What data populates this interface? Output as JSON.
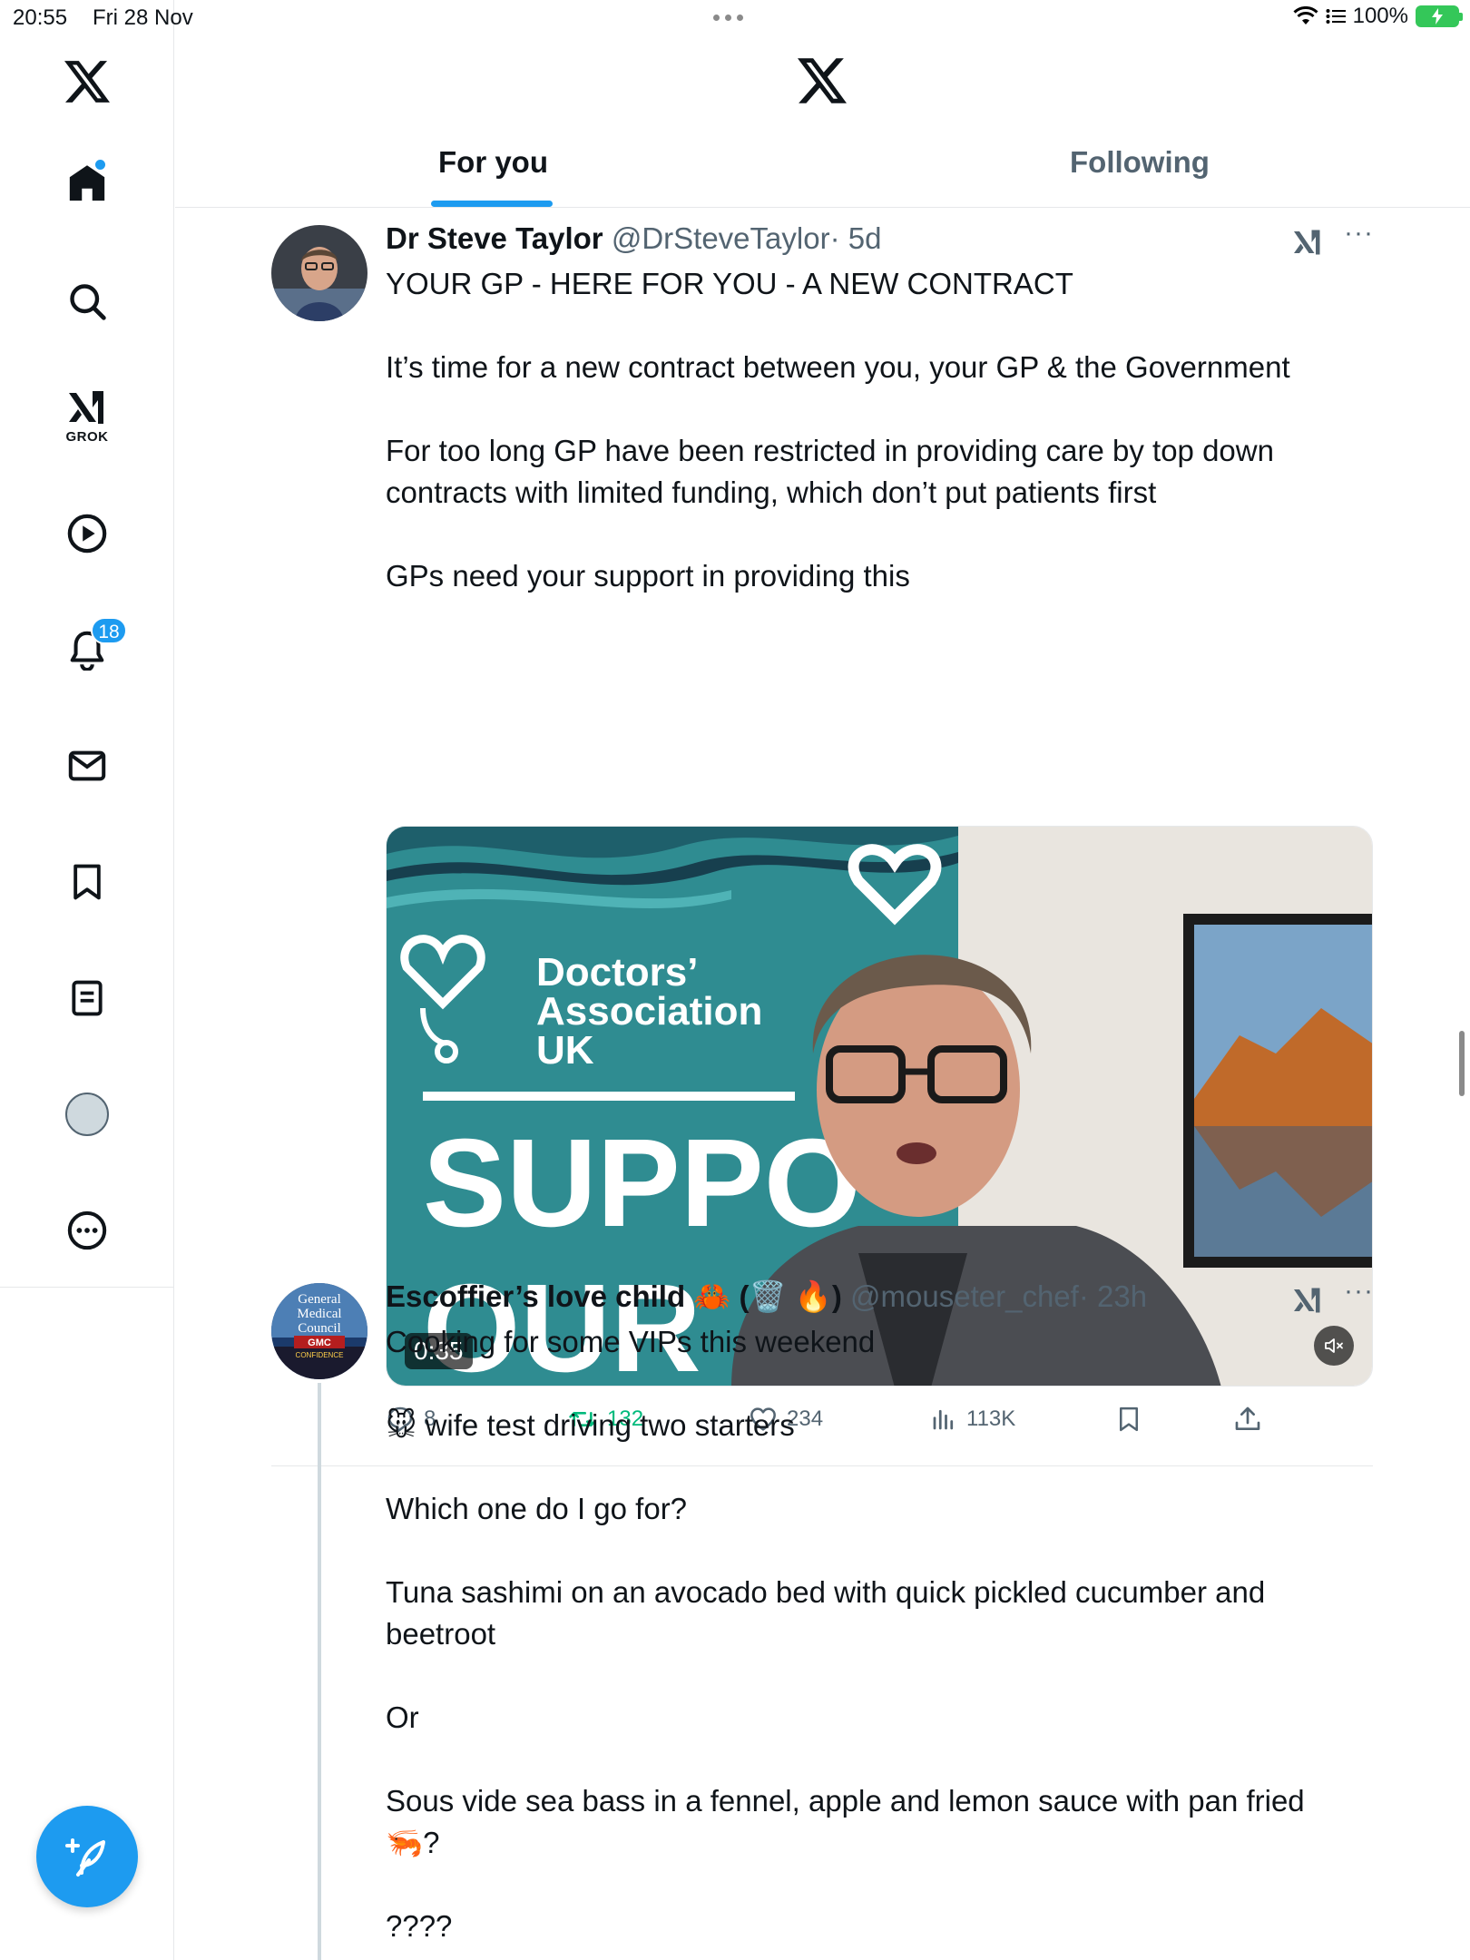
{
  "status_bar": {
    "time": "20:55",
    "date": "Fri 28 Nov",
    "battery": "100%"
  },
  "sidebar": {
    "items": [
      {
        "name": "x-logo"
      },
      {
        "name": "home",
        "has_dot": true
      },
      {
        "name": "search"
      },
      {
        "name": "grok",
        "label": "GROK"
      },
      {
        "name": "video"
      },
      {
        "name": "notifications",
        "badge": "18"
      },
      {
        "name": "messages"
      },
      {
        "name": "bookmarks"
      },
      {
        "name": "lists"
      },
      {
        "name": "profile"
      },
      {
        "name": "more"
      }
    ]
  },
  "header": {
    "tabs": [
      {
        "label": "For you",
        "active": true
      },
      {
        "label": "Following",
        "active": false
      }
    ]
  },
  "tweets": [
    {
      "name": "Dr Steve Taylor",
      "handle": "@DrSteveTaylor",
      "time": "· 5d",
      "text": [
        "YOUR GP - HERE FOR YOU - A NEW CONTRACT",
        "It’s time for a new contract between you, your GP & the Government",
        "For too long GP have been restricted in providing care by top down contracts with limited funding, which don’t put patients first",
        "GPs need your support in providing this"
      ],
      "media": {
        "banner_line1": "Doctors’",
        "banner_line2": "Association",
        "banner_line3": "UK",
        "banner_big": "SUPPO",
        "banner_big2": "OUR",
        "duration": "0:35"
      },
      "stats": {
        "replies": "8",
        "reposts": "132",
        "likes": "234",
        "views": "113K"
      }
    },
    {
      "name": "Escoffier’s love child 🦀 (🗑️ 🔥)",
      "handle": "@mouseter_chef",
      "time": "· 23h",
      "avatar_text": [
        "General",
        "Medical",
        "Council",
        "GMC",
        "CONFIDENCE"
      ],
      "text": [
        "Cooking for some VIPs this weekend",
        "🐭 wife test driving two starters",
        "Which one do I go for?",
        "Tuna sashimi on an avocado bed with quick pickled cucumber and beetroot",
        "Or",
        "Sous vide sea bass in a fennel, apple and lemon sauce with pan fried 🦐?",
        "????"
      ]
    }
  ],
  "colors": {
    "accent": "#1d9bf0",
    "repost": "#00ba7c",
    "secondary_text": "#536471",
    "teal_banner": "#2f8c91"
  }
}
